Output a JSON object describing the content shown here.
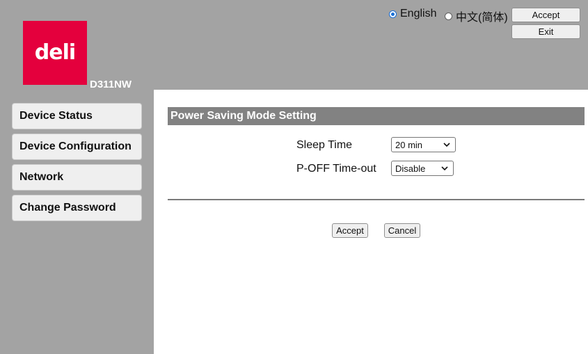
{
  "brand": {
    "logo_text": "deli",
    "model": "D311NW",
    "logo_color": "#e4003d"
  },
  "language": {
    "options": [
      {
        "label": "English",
        "selected": true
      },
      {
        "label": "中文(简体)",
        "selected": false
      }
    ]
  },
  "header_buttons": {
    "accept": "Accept",
    "exit": "Exit"
  },
  "sidebar": {
    "items": [
      {
        "label": "Device Status"
      },
      {
        "label": "Device Configuration"
      },
      {
        "label": "Network"
      },
      {
        "label": "Change Password"
      }
    ]
  },
  "main": {
    "section_title": "Power Saving Mode Setting",
    "fields": [
      {
        "label": "Sleep Time",
        "value": "20 min"
      },
      {
        "label": "P-OFF Time-out",
        "value": "Disable"
      }
    ],
    "buttons": {
      "accept": "Accept",
      "cancel": "Cancel"
    }
  },
  "colors": {
    "background": "#a3a3a3",
    "header_bar": "#828282",
    "content": "#ffffff"
  }
}
